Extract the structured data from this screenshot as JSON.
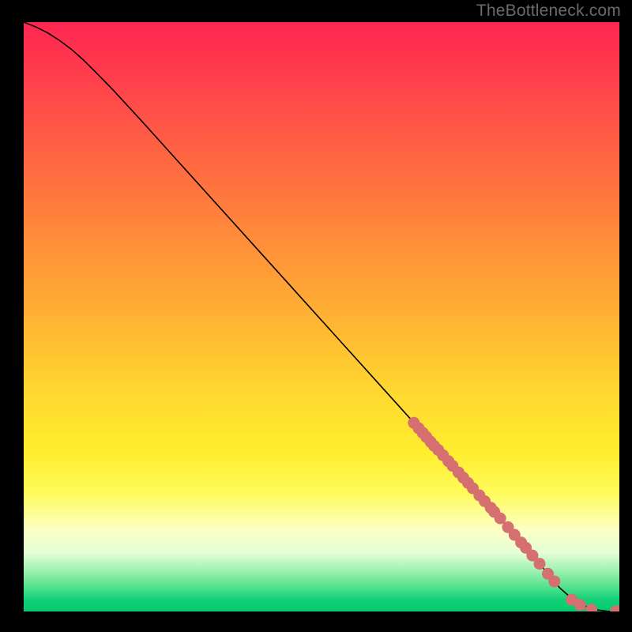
{
  "watermark": "TheBottleneck.com",
  "chart_data": {
    "type": "line",
    "title": "",
    "xlabel": "",
    "ylabel": "",
    "xlim": [
      0,
      100
    ],
    "ylim": [
      0,
      100
    ],
    "curve": {
      "x": [
        0,
        2,
        4,
        6,
        8,
        10,
        12,
        15,
        20,
        25,
        30,
        35,
        40,
        45,
        50,
        55,
        60,
        65,
        70,
        75,
        80,
        85,
        88,
        90,
        92,
        94,
        96,
        98,
        100
      ],
      "y": [
        100,
        99.2,
        98.2,
        96.9,
        95.4,
        93.6,
        91.6,
        88.5,
        83.0,
        77.4,
        71.8,
        66.2,
        60.6,
        55.0,
        49.4,
        43.8,
        38.2,
        32.6,
        27.0,
        21.4,
        15.8,
        10.0,
        6.4,
        4.0,
        2.2,
        1.0,
        0.3,
        0.05,
        0
      ]
    },
    "markers": {
      "color": "#d66f6f",
      "points": [
        {
          "x": 65.5,
          "y": 32.0
        },
        {
          "x": 66.3,
          "y": 31.1
        },
        {
          "x": 67.0,
          "y": 30.3
        },
        {
          "x": 67.6,
          "y": 29.6
        },
        {
          "x": 68.3,
          "y": 28.8
        },
        {
          "x": 68.9,
          "y": 28.1
        },
        {
          "x": 69.6,
          "y": 27.4
        },
        {
          "x": 70.4,
          "y": 26.5
        },
        {
          "x": 71.3,
          "y": 25.5
        },
        {
          "x": 72.0,
          "y": 24.7
        },
        {
          "x": 73.0,
          "y": 23.6
        },
        {
          "x": 73.8,
          "y": 22.7
        },
        {
          "x": 74.6,
          "y": 21.8
        },
        {
          "x": 75.4,
          "y": 20.9
        },
        {
          "x": 76.5,
          "y": 19.7
        },
        {
          "x": 77.4,
          "y": 18.7
        },
        {
          "x": 78.4,
          "y": 17.6
        },
        {
          "x": 79.0,
          "y": 16.9
        },
        {
          "x": 80.0,
          "y": 15.8
        },
        {
          "x": 81.3,
          "y": 14.3
        },
        {
          "x": 82.4,
          "y": 13.0
        },
        {
          "x": 83.5,
          "y": 11.7
        },
        {
          "x": 84.3,
          "y": 10.8
        },
        {
          "x": 85.4,
          "y": 9.5
        },
        {
          "x": 86.6,
          "y": 8.1
        },
        {
          "x": 88.0,
          "y": 6.4
        },
        {
          "x": 89.1,
          "y": 5.1
        },
        {
          "x": 92.0,
          "y": 2.0
        },
        {
          "x": 93.4,
          "y": 1.1
        },
        {
          "x": 95.3,
          "y": 0.3
        },
        {
          "x": 99.4,
          "y": 0.0
        },
        {
          "x": 100.0,
          "y": 0.0
        }
      ]
    }
  }
}
